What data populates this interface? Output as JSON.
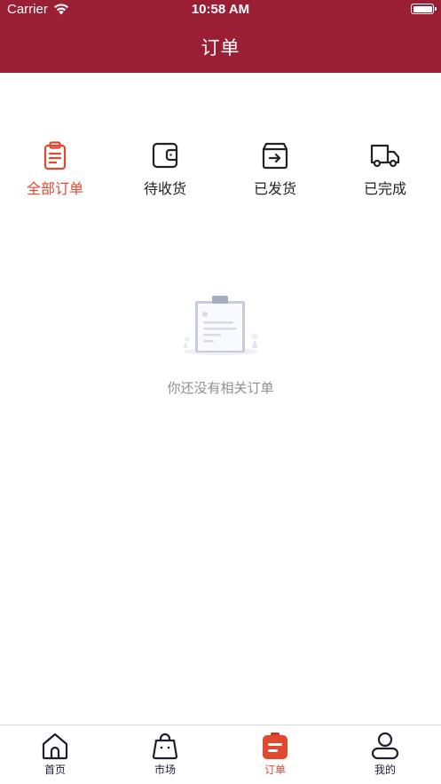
{
  "status_bar": {
    "carrier": "Carrier",
    "time": "10:58 AM"
  },
  "header": {
    "title": "订单",
    "background": "#9b1f34"
  },
  "order_tabs": [
    {
      "label": "全部订单",
      "icon": "clipboard-icon",
      "active": true
    },
    {
      "label": "待收货",
      "icon": "wallet-icon",
      "active": false
    },
    {
      "label": "已发货",
      "icon": "shipping-box-icon",
      "active": false
    },
    {
      "label": "已完成",
      "icon": "truck-icon",
      "active": false
    }
  ],
  "empty_state": {
    "message": "你还没有相关订单",
    "icon": "empty-clipboard-illustration"
  },
  "tab_bar": [
    {
      "label": "首页",
      "icon": "home-icon",
      "active": false
    },
    {
      "label": "市场",
      "icon": "shopping-bag-icon",
      "active": false
    },
    {
      "label": "订单",
      "icon": "order-icon",
      "active": true
    },
    {
      "label": "我的",
      "icon": "profile-icon",
      "active": false
    }
  ],
  "colors": {
    "accent": "#e2482f",
    "text": "#222222",
    "muted": "#8f8f8f",
    "divider": "#d9d9d9"
  }
}
